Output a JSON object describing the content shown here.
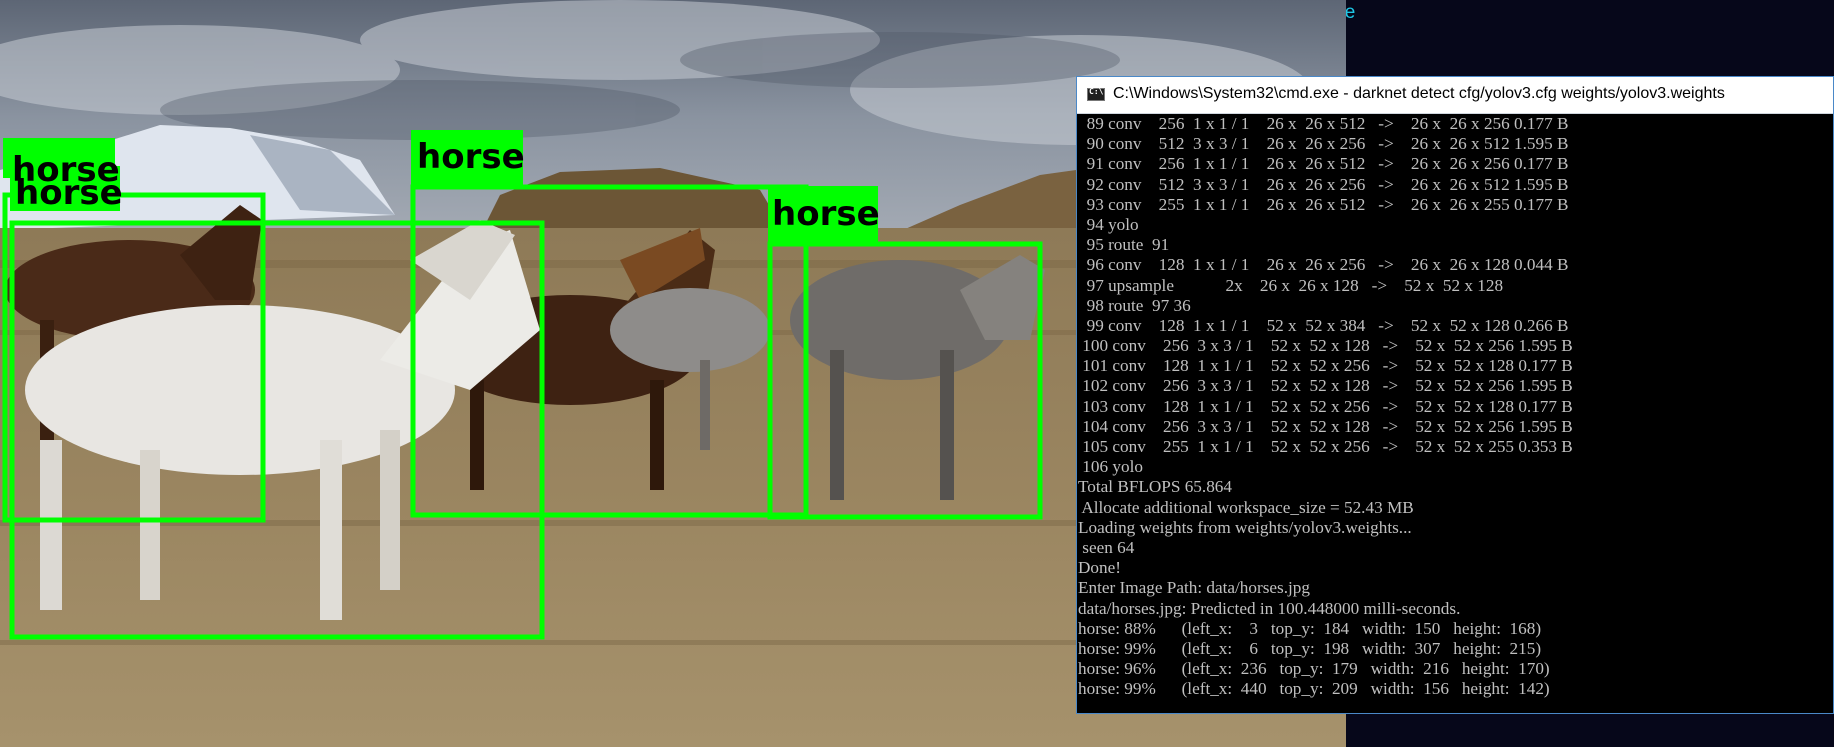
{
  "desktop": {
    "fragment_text": "ole"
  },
  "detection": {
    "label_color": "#00ff00",
    "boxes": [
      {
        "label": "horse"
      },
      {
        "label": "horse"
      },
      {
        "label": "horse"
      },
      {
        "label": "horse"
      }
    ]
  },
  "console": {
    "title": "C:\\Windows\\System32\\cmd.exe - darknet  detect cfg/yolov3.cfg weights/yolov3.weights",
    "text_color": "#c0c0c0",
    "lines": [
      "  89 conv    256  1 x 1 / 1    26 x  26 x 512   ->    26 x  26 x 256 0.177 B",
      "  90 conv    512  3 x 3 / 1    26 x  26 x 256   ->    26 x  26 x 512 1.595 B",
      "  91 conv    256  1 x 1 / 1    26 x  26 x 512   ->    26 x  26 x 256 0.177 B",
      "  92 conv    512  3 x 3 / 1    26 x  26 x 256   ->    26 x  26 x 512 1.595 B",
      "  93 conv    255  1 x 1 / 1    26 x  26 x 512   ->    26 x  26 x 255 0.177 B",
      "  94 yolo",
      "  95 route  91",
      "  96 conv    128  1 x 1 / 1    26 x  26 x 256   ->    26 x  26 x 128 0.044 B",
      "  97 upsample            2x    26 x  26 x 128   ->    52 x  52 x 128",
      "  98 route  97 36",
      "  99 conv    128  1 x 1 / 1    52 x  52 x 384   ->    52 x  52 x 128 0.266 B",
      " 100 conv    256  3 x 3 / 1    52 x  52 x 128   ->    52 x  52 x 256 1.595 B",
      " 101 conv    128  1 x 1 / 1    52 x  52 x 256   ->    52 x  52 x 128 0.177 B",
      " 102 conv    256  3 x 3 / 1    52 x  52 x 128   ->    52 x  52 x 256 1.595 B",
      " 103 conv    128  1 x 1 / 1    52 x  52 x 256   ->    52 x  52 x 128 0.177 B",
      " 104 conv    256  3 x 3 / 1    52 x  52 x 128   ->    52 x  52 x 256 1.595 B",
      " 105 conv    255  1 x 1 / 1    52 x  52 x 256   ->    52 x  52 x 255 0.353 B",
      " 106 yolo",
      "Total BFLOPS 65.864",
      " Allocate additional workspace_size = 52.43 MB",
      "Loading weights from weights/yolov3.weights...",
      " seen 64",
      "Done!",
      "Enter Image Path: data/horses.jpg",
      "data/horses.jpg: Predicted in 100.448000 milli-seconds.",
      "horse: 88%      (left_x:    3   top_y:  184   width:  150   height:  168)",
      "horse: 99%      (left_x:    6   top_y:  198   width:  307   height:  215)",
      "horse: 96%      (left_x:  236   top_y:  179   width:  216   height:  170)",
      "horse: 99%      (left_x:  440   top_y:  209   width:  156   height:  142)"
    ]
  }
}
